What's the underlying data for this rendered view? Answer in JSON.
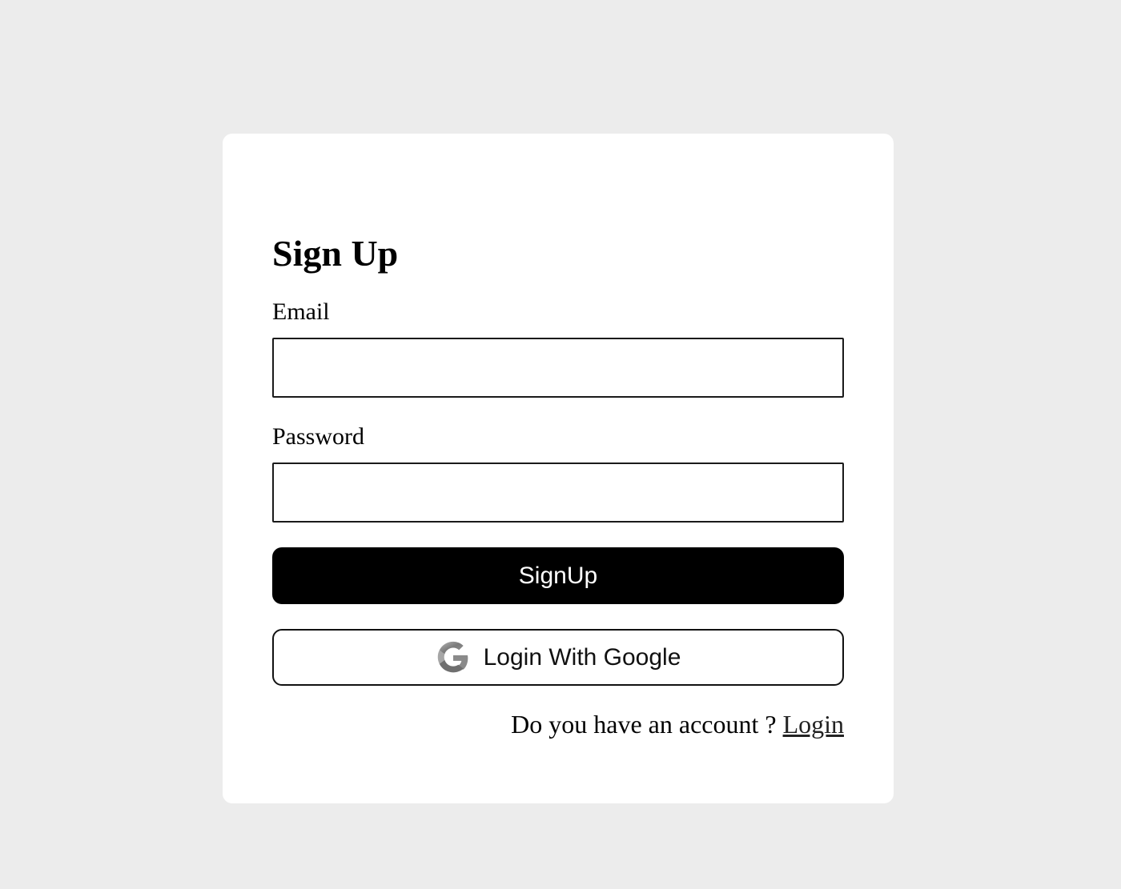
{
  "form": {
    "title": "Sign Up",
    "email_label": "Email",
    "email_value": "",
    "password_label": "Password",
    "password_value": "",
    "signup_label": "SignUp",
    "google_label": "Login With Google",
    "account_prompt": "Do you have an account ?",
    "login_link": "Login"
  },
  "icons": {
    "google": "google-logo-icon"
  },
  "colors": {
    "background": "#ececec",
    "card": "#ffffff",
    "primary_button": "#000000",
    "primary_button_text": "#ffffff"
  }
}
